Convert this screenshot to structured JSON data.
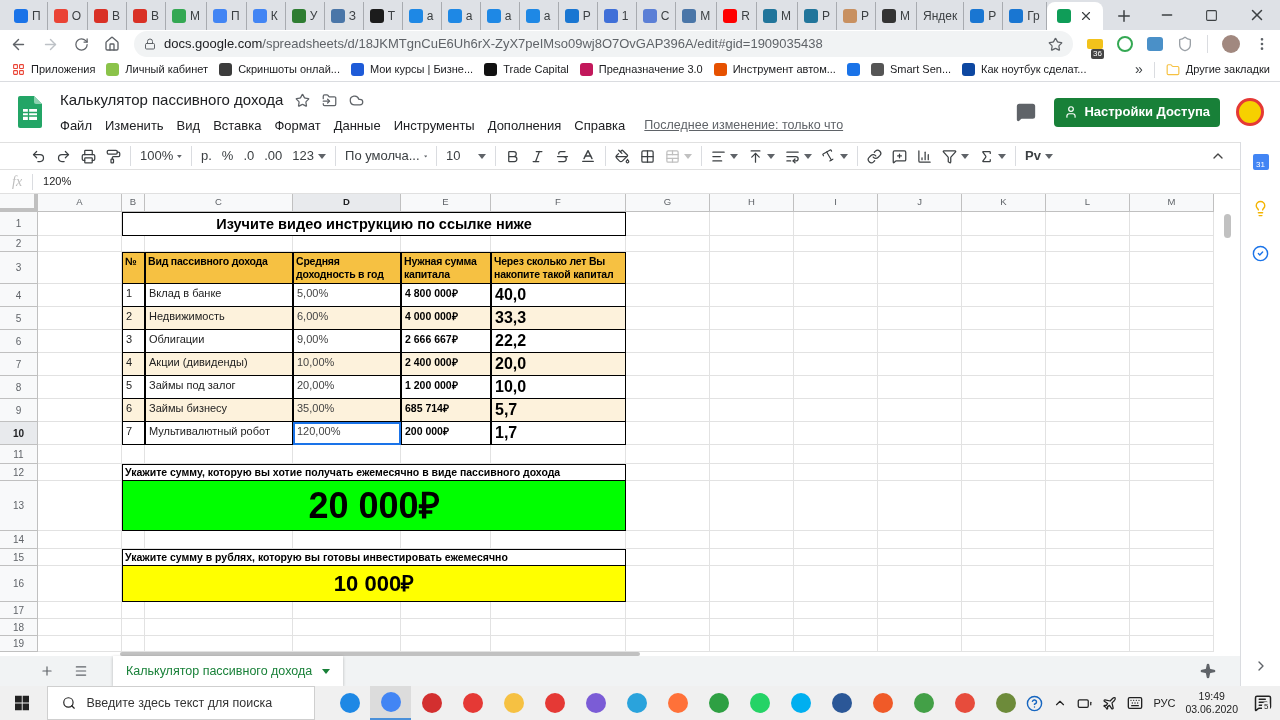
{
  "browser": {
    "tabs": [
      {
        "label": "П",
        "color": "#1a73e8",
        "selected": false
      },
      {
        "label": "О",
        "color": "#ea4335",
        "selected": false
      },
      {
        "label": "В",
        "color": "#d93025",
        "selected": false
      },
      {
        "label": "В",
        "color": "#d93025",
        "selected": false
      },
      {
        "label": "М",
        "color": "#34a853",
        "selected": false
      },
      {
        "label": "П",
        "color": "#4285f4",
        "selected": false
      },
      {
        "label": "К",
        "color": "#4285f4",
        "selected": false
      },
      {
        "label": "У",
        "color": "#2e7d32",
        "selected": false
      },
      {
        "label": "З",
        "color": "#4a76a8",
        "selected": false
      },
      {
        "label": "Т",
        "color": "#1c1c1c",
        "selected": false
      },
      {
        "label": "а",
        "color": "#1e88e5",
        "selected": false
      },
      {
        "label": "а",
        "color": "#1e88e5",
        "selected": false
      },
      {
        "label": "а",
        "color": "#1e88e5",
        "selected": false
      },
      {
        "label": "а",
        "color": "#1e88e5",
        "selected": false
      },
      {
        "label": "Р",
        "color": "#1976d2",
        "selected": false
      },
      {
        "label": "1",
        "color": "#3f6fd8",
        "selected": false
      },
      {
        "label": "С",
        "color": "#5b7fd6",
        "selected": false
      },
      {
        "label": "М",
        "color": "#4a76a8",
        "selected": false
      },
      {
        "label": "R",
        "color": "#ff0000",
        "selected": false
      },
      {
        "label": "М",
        "color": "#21759b",
        "selected": false
      },
      {
        "label": "Р",
        "color": "#21759b",
        "selected": false
      },
      {
        "label": "Р",
        "color": "#c89060",
        "selected": false
      },
      {
        "label": "М",
        "color": "#333333",
        "selected": false
      },
      {
        "label": "Яндек",
        "selected": false
      },
      {
        "label": "Р",
        "color": "#1976d2",
        "selected": false
      },
      {
        "label": "Гр",
        "color": "#1976d2",
        "selected": false
      },
      {
        "color": "#0f9d58",
        "selected": true
      }
    ],
    "address_host": "docs.google.com",
    "address_path": "/spreadsheets/d/18JKMTgnCuE6Uh6rX-ZyX7peIMso09wj8O7OvGAP396A/edit#gid=1909035438",
    "extension_badge": "36",
    "bookmarks": [
      {
        "kind": "apps",
        "label": "Приложения"
      },
      {
        "kind": "link",
        "label": "Личный кабинет",
        "color": "#8bc34a"
      },
      {
        "kind": "link",
        "label": "Скриншоты онлай...",
        "color": "#3c3c3c"
      },
      {
        "kind": "link",
        "label": "Мои курсы | Бизне...",
        "color": "#1e5bd8"
      },
      {
        "kind": "link",
        "label": "Trade Capital",
        "color": "#111111"
      },
      {
        "kind": "link",
        "label": "Предназначение 3.0",
        "color": "#c2185b"
      },
      {
        "kind": "link",
        "label": "Инструмент автом...",
        "color": "#e65100"
      },
      {
        "kind": "link",
        "color": "#1a73e8"
      },
      {
        "kind": "link",
        "label": "Smart Sen...",
        "color": "#555555"
      },
      {
        "kind": "link",
        "label": "Как ноутбук сделат...",
        "color": "#0d47a1"
      }
    ],
    "more": "»",
    "other_bookmarks": "Другие закладки"
  },
  "doc": {
    "title": "Калькулятор пассивного дохода",
    "menu": [
      "Файл",
      "Изменить",
      "Вид",
      "Вставка",
      "Формат",
      "Данные",
      "Инструменты",
      "Дополнения",
      "Справка"
    ],
    "last_edit": "Последнее изменение: только что",
    "share_button": "Настройки Доступа"
  },
  "toolbar": {
    "zoom": "100%",
    "currency": "р.",
    "percent": "%",
    "decrease_decimals": ".0",
    "increase_decimals": ".00",
    "number_format": "123",
    "font": "По умолча...",
    "font_size": "10",
    "addon": "Рv"
  },
  "formula_bar": {
    "label": "fx",
    "value": "120%"
  },
  "columns": [
    "A",
    "B",
    "C",
    "D",
    "E",
    "F",
    "G",
    "H",
    "I",
    "J",
    "K",
    "L",
    "M"
  ],
  "row_numbers": [
    "1",
    "2",
    "3",
    "4",
    "5",
    "6",
    "7",
    "8",
    "9",
    "10",
    "11",
    "12",
    "13",
    "14",
    "15",
    "16",
    "17",
    "18",
    "19"
  ],
  "sheet": {
    "title": "Изучите видео инструкцию по ссылке ниже",
    "headers": [
      "№",
      "Вид пассивного дохода",
      "Средняя доходность в год",
      "Нужная сумма капитала",
      "Через сколько лет Вы накопите такой капитал"
    ],
    "rows": [
      [
        {
          "text": "1",
          "selected": false
        },
        {
          "text": "Вклад в банке",
          "selected": false
        },
        {
          "text": "5,00%",
          "selected": false
        },
        {
          "text": "4 800 000₽",
          "selected": false
        },
        {
          "text": "40,0",
          "selected": false
        }
      ],
      [
        {
          "text": "2",
          "selected": false
        },
        {
          "text": "Недвижимость",
          "selected": false
        },
        {
          "text": "6,00%",
          "selected": false
        },
        {
          "text": "4 000 000₽",
          "selected": false
        },
        {
          "text": "33,3",
          "selected": false
        }
      ],
      [
        {
          "text": "3",
          "selected": false
        },
        {
          "text": "Облигации",
          "selected": false
        },
        {
          "text": "9,00%",
          "selected": false
        },
        {
          "text": "2 666 667₽",
          "selected": false
        },
        {
          "text": "22,2",
          "selected": false
        }
      ],
      [
        {
          "text": "4",
          "selected": false
        },
        {
          "text": "Акции (дивиденды)",
          "selected": false
        },
        {
          "text": "10,00%",
          "selected": false
        },
        {
          "text": "2 400 000₽",
          "selected": false
        },
        {
          "text": "20,0",
          "selected": false
        }
      ],
      [
        {
          "text": "5",
          "selected": false
        },
        {
          "text": "Займы под залог",
          "selected": false
        },
        {
          "text": "20,00%",
          "selected": false
        },
        {
          "text": "1 200 000₽",
          "selected": false
        },
        {
          "text": "10,0",
          "selected": false
        }
      ],
      [
        {
          "text": "6",
          "selected": false
        },
        {
          "text": "Займы бизнесу",
          "selected": false
        },
        {
          "text": "35,00%",
          "selected": false
        },
        {
          "text": "685 714₽",
          "selected": false
        },
        {
          "text": "5,7",
          "selected": false
        }
      ],
      [
        {
          "text": "7",
          "selected": false
        },
        {
          "text": "Мультивалютный робот",
          "selected": false
        },
        {
          "text": "120,00%",
          "selected": true
        },
        {
          "text": "200 000₽",
          "selected": false
        },
        {
          "text": "1,7",
          "selected": false
        }
      ]
    ],
    "income_label": "Укажите сумму, которую вы хотие получать ежемесячно в виде пассивного дохода",
    "income_value": "20 000₽",
    "invest_label": "Укажите сумму в рублях, которую вы готовы инвестировать ежемесячно",
    "invest_value": "10 000₽"
  },
  "side_panel": {
    "calendar_day": "31"
  },
  "sheet_tabs": [
    {
      "label": "Калькулятор пассивного дохода",
      "selected": true
    }
  ],
  "taskbar": {
    "search_placeholder": "Введите здесь текст для поиска",
    "language": "РУС",
    "time": "19:49",
    "date": "03.06.2020",
    "notifications": "5"
  }
}
